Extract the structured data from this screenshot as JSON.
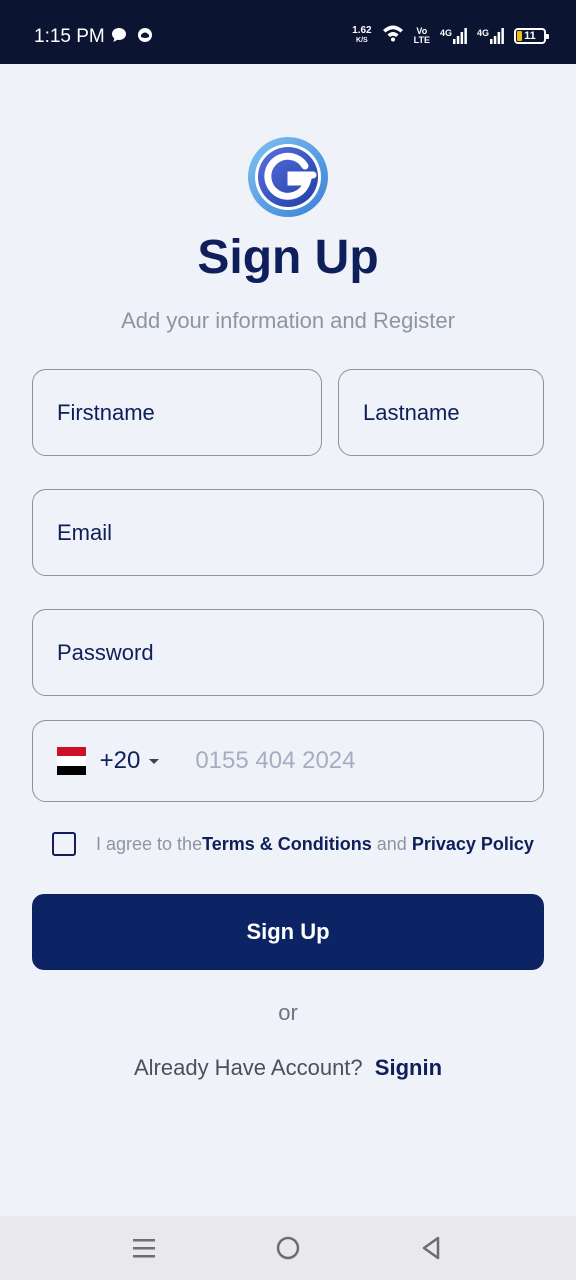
{
  "status_bar": {
    "time": "1:15 PM",
    "net_speed": "1.62",
    "net_speed_unit": "K/S",
    "volte_top": "Vo",
    "volte_bottom": "LTE",
    "net_type_1": "4G",
    "net_type_2": "4G",
    "battery_level": "11",
    "icons": [
      "chat-bubble-icon",
      "notification-icon",
      "wifi-icon",
      "signal-icon",
      "signal-icon",
      "battery-icon"
    ]
  },
  "brand": {
    "logo_icon": "app-logo-icon"
  },
  "header": {
    "title": "Sign Up",
    "subtitle": "Add your information and Register"
  },
  "form": {
    "firstname_placeholder": "Firstname",
    "lastname_placeholder": "Lastname",
    "email_placeholder": "Email",
    "password_placeholder": "Password",
    "phone": {
      "country_code": "+20",
      "flag": "egypt-flag-icon",
      "placeholder": "0155 404 2024"
    },
    "agree": {
      "prefix": "I agree to the",
      "terms_link": "Terms & Conditions",
      "and": "and",
      "privacy_link": "Privacy Policy"
    },
    "submit_label": "Sign Up"
  },
  "footer": {
    "or_text": "or",
    "already_text": "Already Have Account?",
    "signin_link": "Signin"
  },
  "nav_bar": {
    "icons": [
      "menu-icon",
      "home-icon",
      "back-icon"
    ]
  },
  "colors": {
    "primary": "#0d2464",
    "heading": "#0e1f5b",
    "background": "#eff2f8",
    "status_bar": "#0b1431"
  }
}
